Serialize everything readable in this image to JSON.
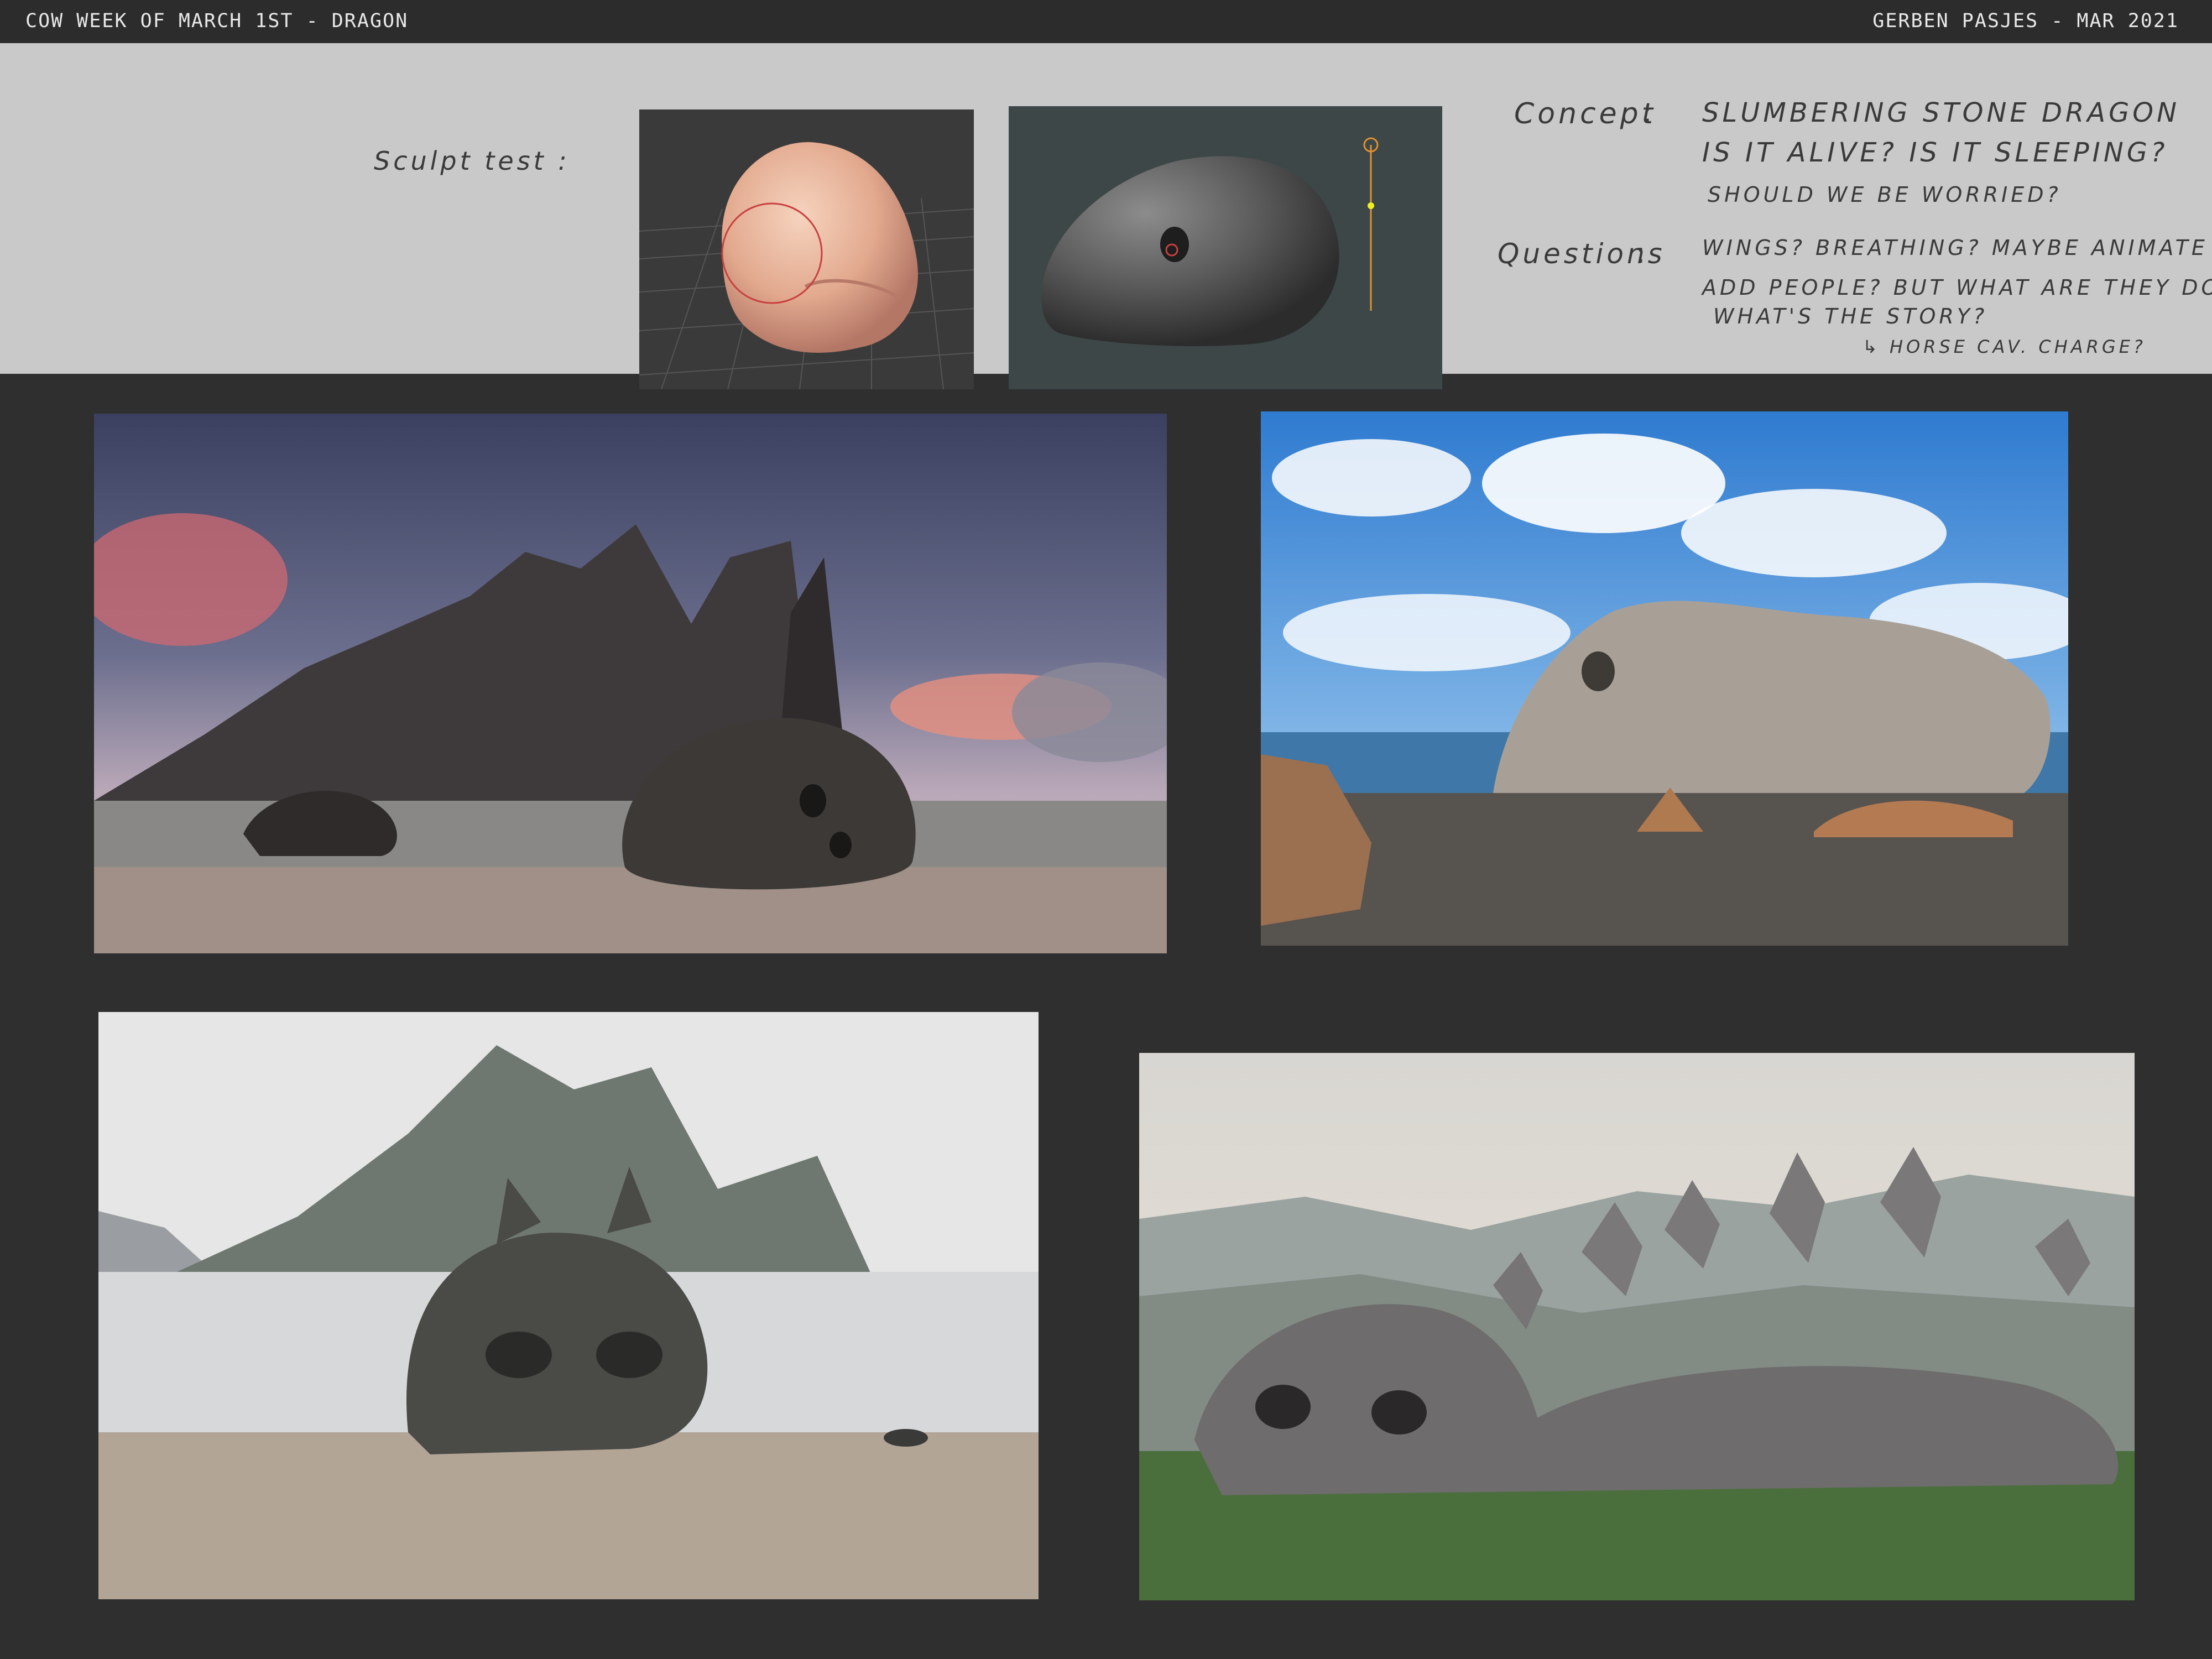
{
  "header": {
    "left_title": "COW WEEK OF MARCH 1ST - DRAGON",
    "right_title": "GERBEN PASJES - MAR 2021"
  },
  "notes": {
    "sculpt_label": "Sculpt test :",
    "concept_label": "Concept",
    "concept_lines": [
      "SLUMBERING STONE DRAGON",
      "IS IT ALIVE? IS IT SLEEPING?",
      "SHOULD WE BE WORRIED?"
    ],
    "questions_label": "Questions",
    "question_lines": [
      "WINGS? BREATHING? MAYBE ANIMATE IT?",
      "ADD PEOPLE? BUT WHAT ARE THEY DOING?",
      "WHAT'S THE STORY?",
      "↳ HORSE CAV. CHARGE?"
    ]
  },
  "colors": {
    "background": "#2f2f2f",
    "notes_band": "#c9c9c9",
    "header_text": "#e8e8e8"
  },
  "icons": {
    "sculpt_viewport_1": "clay-head-sculpt",
    "sculpt_viewport_2": "stone-head-render",
    "panel_1": "dusk-beach-dragon-painting",
    "panel_2": "sunny-coast-dragon-painting",
    "panel_3": "misty-beach-dragon-head-painting",
    "panel_4": "spiked-stone-dragon-painting"
  }
}
